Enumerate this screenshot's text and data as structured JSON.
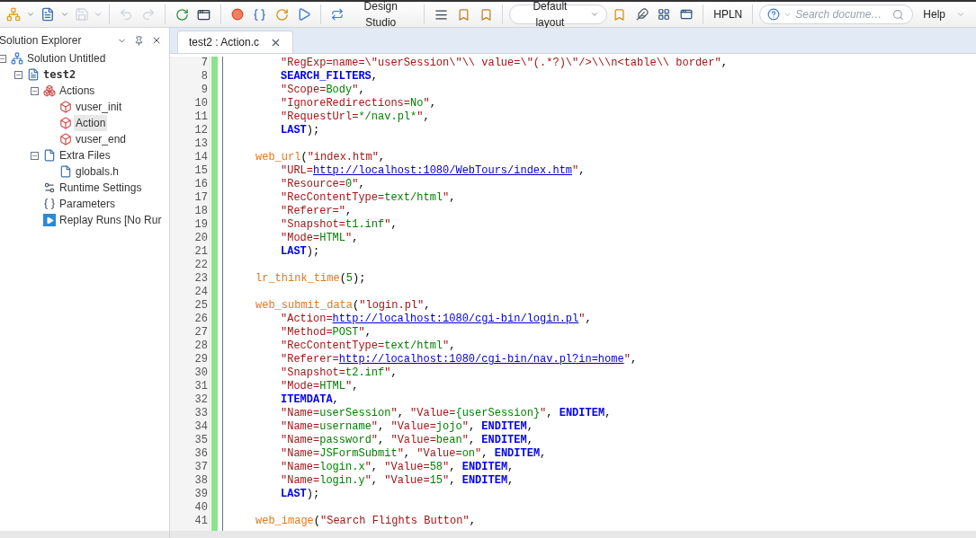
{
  "toolbar": {
    "save_disabled": true,
    "undo_disabled": true,
    "redo_disabled": true,
    "design_studio": "Design Studio",
    "layout": "Default layout",
    "hpln": "HPLN",
    "search": {
      "placeholder": "Search docume…"
    },
    "help": "Help"
  },
  "solution_explorer": {
    "title": "Solution Explorer",
    "tree": [
      {
        "kind": "solution",
        "label": "Solution Untitled",
        "expanded": true,
        "selected": false,
        "children": [
          {
            "kind": "script",
            "label": "test2",
            "expanded": true,
            "selected": false,
            "children": [
              {
                "kind": "actions",
                "label": "Actions",
                "expanded": true,
                "selected": false,
                "children": [
                  {
                    "kind": "action",
                    "label": "vuser_init",
                    "selected": false
                  },
                  {
                    "kind": "action",
                    "label": "Action",
                    "selected": true
                  },
                  {
                    "kind": "action",
                    "label": "vuser_end",
                    "selected": false
                  }
                ]
              },
              {
                "kind": "files",
                "label": "Extra Files",
                "expanded": true,
                "selected": false,
                "children": [
                  {
                    "kind": "file",
                    "label": "globals.h",
                    "selected": false
                  }
                ]
              },
              {
                "kind": "settings",
                "label": "Runtime Settings",
                "selected": false
              },
              {
                "kind": "parameters",
                "label": "Parameters",
                "selected": false
              },
              {
                "kind": "runs",
                "label": "Replay Runs [No Rur",
                "selected": false
              }
            ]
          }
        ]
      }
    ]
  },
  "tabs": [
    {
      "label": "test2 : Action.c",
      "selected": true
    }
  ],
  "editor": {
    "lines": [
      {
        "number": "7",
        "kind": "argument",
        "tokens": [
          {
            "kind": "key",
            "text": "\"RegExp=name=\\\"userSession\\\"\\\\ value=\\\"(.*?)\\\"/>\\\\\\n<table\\\\ border\""
          },
          {
            "kind": "punct",
            "text": ","
          }
        ]
      },
      {
        "number": "8",
        "kind": "argument",
        "tokens": [
          {
            "kind": "keyword",
            "text": "SEARCH_FILTERS"
          },
          {
            "kind": "punct",
            "text": ","
          }
        ]
      },
      {
        "number": "9",
        "kind": "argument",
        "tokens": [
          {
            "kind": "key",
            "text": "\"Scope="
          },
          {
            "kind": "value",
            "text": "Body"
          },
          {
            "kind": "key",
            "text": "\""
          },
          {
            "kind": "punct",
            "text": ","
          }
        ]
      },
      {
        "number": "10",
        "kind": "argument",
        "tokens": [
          {
            "kind": "key",
            "text": "\"IgnoreRedirections="
          },
          {
            "kind": "value",
            "text": "No"
          },
          {
            "kind": "key",
            "text": "\""
          },
          {
            "kind": "punct",
            "text": ","
          }
        ]
      },
      {
        "number": "11",
        "kind": "argument",
        "tokens": [
          {
            "kind": "key",
            "text": "\"RequestUrl="
          },
          {
            "kind": "value",
            "text": "*/nav.pl*"
          },
          {
            "kind": "key",
            "text": "\""
          },
          {
            "kind": "punct",
            "text": ","
          }
        ]
      },
      {
        "number": "12",
        "kind": "argument",
        "tokens": [
          {
            "kind": "keyword",
            "text": "LAST"
          },
          {
            "kind": "punct",
            "text": ");"
          }
        ]
      },
      {
        "number": "13",
        "kind": "blank"
      },
      {
        "number": "14",
        "kind": "statement",
        "tokens": [
          {
            "kind": "function",
            "text": "web_url"
          },
          {
            "kind": "punct",
            "text": "("
          },
          {
            "kind": "string",
            "text": "\"index.htm\""
          },
          {
            "kind": "punct",
            "text": ","
          }
        ]
      },
      {
        "number": "15",
        "kind": "argument",
        "tokens": [
          {
            "kind": "key",
            "text": "\"URL="
          },
          {
            "kind": "link",
            "text": "http://localhost:1080/WebTours/index.htm"
          },
          {
            "kind": "key",
            "text": "\""
          },
          {
            "kind": "punct",
            "text": ","
          }
        ]
      },
      {
        "number": "16",
        "kind": "argument",
        "tokens": [
          {
            "kind": "key",
            "text": "\"Resource="
          },
          {
            "kind": "value",
            "text": "0"
          },
          {
            "kind": "key",
            "text": "\""
          },
          {
            "kind": "punct",
            "text": ","
          }
        ]
      },
      {
        "number": "17",
        "kind": "argument",
        "tokens": [
          {
            "kind": "key",
            "text": "\"RecContentType="
          },
          {
            "kind": "value",
            "text": "text/html"
          },
          {
            "kind": "key",
            "text": "\""
          },
          {
            "kind": "punct",
            "text": ","
          }
        ]
      },
      {
        "number": "18",
        "kind": "argument",
        "tokens": [
          {
            "kind": "key",
            "text": "\"Referer=\""
          },
          {
            "kind": "punct",
            "text": ","
          }
        ]
      },
      {
        "number": "19",
        "kind": "argument",
        "tokens": [
          {
            "kind": "key",
            "text": "\"Snapshot="
          },
          {
            "kind": "value",
            "text": "t1.inf"
          },
          {
            "kind": "key",
            "text": "\""
          },
          {
            "kind": "punct",
            "text": ","
          }
        ]
      },
      {
        "number": "20",
        "kind": "argument",
        "tokens": [
          {
            "kind": "key",
            "text": "\"Mode="
          },
          {
            "kind": "value",
            "text": "HTML"
          },
          {
            "kind": "key",
            "text": "\""
          },
          {
            "kind": "punct",
            "text": ","
          }
        ]
      },
      {
        "number": "21",
        "kind": "argument",
        "tokens": [
          {
            "kind": "keyword",
            "text": "LAST"
          },
          {
            "kind": "punct",
            "text": ");"
          }
        ]
      },
      {
        "number": "22",
        "kind": "blank"
      },
      {
        "number": "23",
        "kind": "statement",
        "tokens": [
          {
            "kind": "function",
            "text": "lr_think_time"
          },
          {
            "kind": "punct",
            "text": "("
          },
          {
            "kind": "value",
            "text": "5"
          },
          {
            "kind": "punct",
            "text": ");"
          }
        ]
      },
      {
        "number": "24",
        "kind": "blank"
      },
      {
        "number": "25",
        "kind": "statement",
        "tokens": [
          {
            "kind": "function",
            "text": "web_submit_data"
          },
          {
            "kind": "punct",
            "text": "("
          },
          {
            "kind": "string",
            "text": "\"login.pl\""
          },
          {
            "kind": "punct",
            "text": ","
          }
        ]
      },
      {
        "number": "26",
        "kind": "argument",
        "tokens": [
          {
            "kind": "key",
            "text": "\"Action="
          },
          {
            "kind": "link",
            "text": "http://localhost:1080/cgi-bin/login.pl"
          },
          {
            "kind": "key",
            "text": "\""
          },
          {
            "kind": "punct",
            "text": ","
          }
        ]
      },
      {
        "number": "27",
        "kind": "argument",
        "tokens": [
          {
            "kind": "key",
            "text": "\"Method="
          },
          {
            "kind": "value",
            "text": "POST"
          },
          {
            "kind": "key",
            "text": "\""
          },
          {
            "kind": "punct",
            "text": ","
          }
        ]
      },
      {
        "number": "28",
        "kind": "argument",
        "tokens": [
          {
            "kind": "key",
            "text": "\"RecContentType="
          },
          {
            "kind": "value",
            "text": "text/html"
          },
          {
            "kind": "key",
            "text": "\""
          },
          {
            "kind": "punct",
            "text": ","
          }
        ]
      },
      {
        "number": "29",
        "kind": "argument",
        "tokens": [
          {
            "kind": "key",
            "text": "\"Referer="
          },
          {
            "kind": "link",
            "text": "http://localhost:1080/cgi-bin/nav.pl?in=home"
          },
          {
            "kind": "key",
            "text": "\""
          },
          {
            "kind": "punct",
            "text": ","
          }
        ]
      },
      {
        "number": "30",
        "kind": "argument",
        "tokens": [
          {
            "kind": "key",
            "text": "\"Snapshot="
          },
          {
            "kind": "value",
            "text": "t2.inf"
          },
          {
            "kind": "key",
            "text": "\""
          },
          {
            "kind": "punct",
            "text": ","
          }
        ]
      },
      {
        "number": "31",
        "kind": "argument",
        "tokens": [
          {
            "kind": "key",
            "text": "\"Mode="
          },
          {
            "kind": "value",
            "text": "HTML"
          },
          {
            "kind": "key",
            "text": "\""
          },
          {
            "kind": "punct",
            "text": ","
          }
        ]
      },
      {
        "number": "32",
        "kind": "argument",
        "tokens": [
          {
            "kind": "keyword",
            "text": "ITEMDATA"
          },
          {
            "kind": "punct",
            "text": ","
          }
        ]
      },
      {
        "number": "33",
        "kind": "argument",
        "tokens": [
          {
            "kind": "key",
            "text": "\"Name="
          },
          {
            "kind": "value",
            "text": "userSession"
          },
          {
            "kind": "key",
            "text": "\""
          },
          {
            "kind": "punct",
            "text": ", "
          },
          {
            "kind": "key",
            "text": "\"Value="
          },
          {
            "kind": "value",
            "text": "{userSession}"
          },
          {
            "kind": "key",
            "text": "\""
          },
          {
            "kind": "punct",
            "text": ", "
          },
          {
            "kind": "keyword",
            "text": "ENDITEM"
          },
          {
            "kind": "punct",
            "text": ","
          }
        ]
      },
      {
        "number": "34",
        "kind": "argument",
        "tokens": [
          {
            "kind": "key",
            "text": "\"Name="
          },
          {
            "kind": "value",
            "text": "username"
          },
          {
            "kind": "key",
            "text": "\""
          },
          {
            "kind": "punct",
            "text": ", "
          },
          {
            "kind": "key",
            "text": "\"Value="
          },
          {
            "kind": "value",
            "text": "jojo"
          },
          {
            "kind": "key",
            "text": "\""
          },
          {
            "kind": "punct",
            "text": ", "
          },
          {
            "kind": "keyword",
            "text": "ENDITEM"
          },
          {
            "kind": "punct",
            "text": ","
          }
        ]
      },
      {
        "number": "35",
        "kind": "argument",
        "tokens": [
          {
            "kind": "key",
            "text": "\"Name="
          },
          {
            "kind": "value",
            "text": "password"
          },
          {
            "kind": "key",
            "text": "\""
          },
          {
            "kind": "punct",
            "text": ", "
          },
          {
            "kind": "key",
            "text": "\"Value="
          },
          {
            "kind": "value",
            "text": "bean"
          },
          {
            "kind": "key",
            "text": "\""
          },
          {
            "kind": "punct",
            "text": ", "
          },
          {
            "kind": "keyword",
            "text": "ENDITEM"
          },
          {
            "kind": "punct",
            "text": ","
          }
        ]
      },
      {
        "number": "36",
        "kind": "argument",
        "tokens": [
          {
            "kind": "key",
            "text": "\"Name="
          },
          {
            "kind": "value",
            "text": "JSFormSubmit"
          },
          {
            "kind": "key",
            "text": "\""
          },
          {
            "kind": "punct",
            "text": ", "
          },
          {
            "kind": "key",
            "text": "\"Value="
          },
          {
            "kind": "value",
            "text": "on"
          },
          {
            "kind": "key",
            "text": "\""
          },
          {
            "kind": "punct",
            "text": ", "
          },
          {
            "kind": "keyword",
            "text": "ENDITEM"
          },
          {
            "kind": "punct",
            "text": ","
          }
        ]
      },
      {
        "number": "37",
        "kind": "argument",
        "tokens": [
          {
            "kind": "key",
            "text": "\"Name="
          },
          {
            "kind": "value",
            "text": "login.x"
          },
          {
            "kind": "key",
            "text": "\""
          },
          {
            "kind": "punct",
            "text": ", "
          },
          {
            "kind": "key",
            "text": "\"Value="
          },
          {
            "kind": "value",
            "text": "58"
          },
          {
            "kind": "key",
            "text": "\""
          },
          {
            "kind": "punct",
            "text": ", "
          },
          {
            "kind": "keyword",
            "text": "ENDITEM"
          },
          {
            "kind": "punct",
            "text": ","
          }
        ]
      },
      {
        "number": "38",
        "kind": "argument",
        "tokens": [
          {
            "kind": "key",
            "text": "\"Name="
          },
          {
            "kind": "value",
            "text": "login.y"
          },
          {
            "kind": "key",
            "text": "\""
          },
          {
            "kind": "punct",
            "text": ", "
          },
          {
            "kind": "key",
            "text": "\"Value="
          },
          {
            "kind": "value",
            "text": "15"
          },
          {
            "kind": "key",
            "text": "\""
          },
          {
            "kind": "punct",
            "text": ", "
          },
          {
            "kind": "keyword",
            "text": "ENDITEM"
          },
          {
            "kind": "punct",
            "text": ","
          }
        ]
      },
      {
        "number": "39",
        "kind": "argument",
        "tokens": [
          {
            "kind": "keyword",
            "text": "LAST"
          },
          {
            "kind": "punct",
            "text": ");"
          }
        ]
      },
      {
        "number": "40",
        "kind": "blank"
      },
      {
        "number": "41",
        "kind": "statement",
        "tokens": [
          {
            "kind": "function",
            "text": "web_image"
          },
          {
            "kind": "punct",
            "text": "("
          },
          {
            "kind": "string",
            "text": "\"Search Flights Button\""
          },
          {
            "kind": "punct",
            "text": ","
          }
        ]
      }
    ]
  }
}
